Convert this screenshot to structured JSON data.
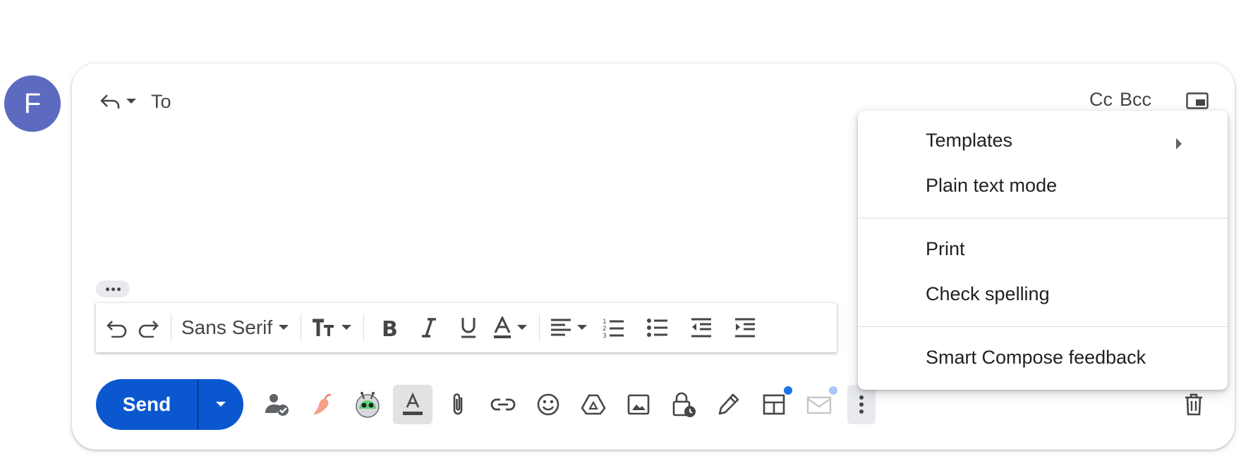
{
  "avatar": {
    "initial": "F",
    "color": "#5c6bc0"
  },
  "header": {
    "to_label": "To",
    "cc_label": "Cc",
    "bcc_label": "Bcc"
  },
  "format_bar": {
    "font_name": "Sans Serif"
  },
  "send": {
    "label": "Send",
    "color": "#0b57d0"
  },
  "menu": {
    "items": [
      {
        "label": "Templates",
        "has_submenu": true
      },
      {
        "label": "Plain text mode"
      },
      {
        "label": "Print"
      },
      {
        "label": "Check spelling"
      },
      {
        "label": "Smart Compose feedback"
      }
    ]
  },
  "toolbar_icons": [
    "signature-check-icon",
    "pepper-extension-icon",
    "android-bot-extension-icon",
    "text-format-icon",
    "attach-icon",
    "link-icon",
    "emoji-icon",
    "drive-icon",
    "image-icon",
    "confidential-mode-icon",
    "pen-signature-icon",
    "layouts-icon",
    "mail-merge-icon",
    "more-options-icon"
  ]
}
